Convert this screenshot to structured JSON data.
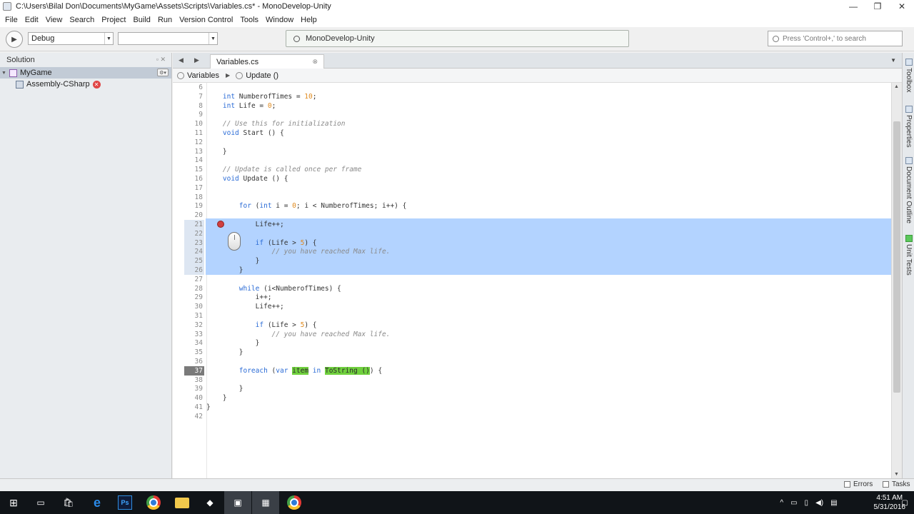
{
  "window": {
    "title": "C:\\Users\\Bilal Don\\Documents\\MyGame\\Assets\\Scripts\\Variables.cs* - MonoDevelop-Unity",
    "controls": [
      "—",
      "❐",
      "✕"
    ]
  },
  "menu": [
    "File",
    "Edit",
    "View",
    "Search",
    "Project",
    "Build",
    "Run",
    "Version Control",
    "Tools",
    "Window",
    "Help"
  ],
  "toolbar": {
    "config_value": "Debug",
    "target_value": "",
    "status_text": "MonoDevelop-Unity",
    "search_placeholder": "Press 'Control+,' to search"
  },
  "solution": {
    "header": "Solution",
    "project": "MyGame",
    "assembly": "Assembly-CSharp"
  },
  "tabs": [
    {
      "label": "Variables.cs"
    }
  ],
  "breadcrumb": {
    "class": "Variables",
    "method": "Update ()"
  },
  "editor": {
    "current_line": 37,
    "selected_lines": [
      21,
      26
    ],
    "lines": [
      {
        "n": "6",
        "parts": []
      },
      {
        "n": "7",
        "parts": [
          {
            "t": "    "
          },
          {
            "t": "int",
            "c": "kw"
          },
          {
            "t": " NumberofTimes = "
          },
          {
            "t": "10",
            "c": "num"
          },
          {
            "t": ";"
          }
        ]
      },
      {
        "n": "8",
        "parts": [
          {
            "t": "    "
          },
          {
            "t": "int",
            "c": "kw"
          },
          {
            "t": " Life = "
          },
          {
            "t": "0",
            "c": "num"
          },
          {
            "t": ";"
          }
        ]
      },
      {
        "n": "9",
        "parts": []
      },
      {
        "n": "10",
        "parts": [
          {
            "t": "    "
          },
          {
            "t": "// Use this for initialization",
            "c": "cm"
          }
        ]
      },
      {
        "n": "11",
        "parts": [
          {
            "t": "    "
          },
          {
            "t": "void",
            "c": "kw"
          },
          {
            "t": " Start () {"
          }
        ]
      },
      {
        "n": "12",
        "parts": []
      },
      {
        "n": "13",
        "parts": [
          {
            "t": "    }"
          }
        ]
      },
      {
        "n": "14",
        "parts": []
      },
      {
        "n": "15",
        "parts": [
          {
            "t": "    "
          },
          {
            "t": "// Update is called once per frame",
            "c": "cm"
          }
        ]
      },
      {
        "n": "16",
        "parts": [
          {
            "t": "    "
          },
          {
            "t": "void",
            "c": "kw"
          },
          {
            "t": " Update () {"
          }
        ]
      },
      {
        "n": "17",
        "parts": []
      },
      {
        "n": "18",
        "parts": []
      },
      {
        "n": "19",
        "parts": [
          {
            "t": "        "
          },
          {
            "t": "for",
            "c": "kw"
          },
          {
            "t": " ("
          },
          {
            "t": "int",
            "c": "kw"
          },
          {
            "t": " i = "
          },
          {
            "t": "0",
            "c": "num"
          },
          {
            "t": "; i < NumberofTimes; i++) {"
          }
        ]
      },
      {
        "n": "20",
        "parts": []
      },
      {
        "n": "21",
        "parts": [
          {
            "t": "            Life++;"
          }
        ]
      },
      {
        "n": "22",
        "parts": []
      },
      {
        "n": "23",
        "parts": [
          {
            "t": "            "
          },
          {
            "t": "if",
            "c": "kw"
          },
          {
            "t": " (Life > "
          },
          {
            "t": "5",
            "c": "num"
          },
          {
            "t": ") {"
          }
        ]
      },
      {
        "n": "24",
        "parts": [
          {
            "t": "                "
          },
          {
            "t": "// you have reached Max life.",
            "c": "cm"
          }
        ]
      },
      {
        "n": "25",
        "parts": [
          {
            "t": "            }"
          }
        ]
      },
      {
        "n": "26",
        "parts": [
          {
            "t": "        }"
          }
        ]
      },
      {
        "n": "27",
        "parts": []
      },
      {
        "n": "28",
        "parts": [
          {
            "t": "        "
          },
          {
            "t": "while",
            "c": "kw"
          },
          {
            "t": " (i<NumberofTimes) {"
          }
        ]
      },
      {
        "n": "29",
        "parts": [
          {
            "t": "            i++;"
          }
        ]
      },
      {
        "n": "30",
        "parts": [
          {
            "t": "            Life++;"
          }
        ]
      },
      {
        "n": "31",
        "parts": []
      },
      {
        "n": "32",
        "parts": [
          {
            "t": "            "
          },
          {
            "t": "if",
            "c": "kw"
          },
          {
            "t": " (Life > "
          },
          {
            "t": "5",
            "c": "num"
          },
          {
            "t": ") {"
          }
        ]
      },
      {
        "n": "33",
        "parts": [
          {
            "t": "                "
          },
          {
            "t": "// you have reached Max life.",
            "c": "cm"
          }
        ]
      },
      {
        "n": "34",
        "parts": [
          {
            "t": "            }"
          }
        ]
      },
      {
        "n": "35",
        "parts": [
          {
            "t": "        }"
          }
        ]
      },
      {
        "n": "36",
        "parts": []
      },
      {
        "n": "37",
        "parts": [
          {
            "t": "        "
          },
          {
            "t": "foreach",
            "c": "kw"
          },
          {
            "t": " ("
          },
          {
            "t": "var",
            "c": "kw"
          },
          {
            "t": " "
          },
          {
            "t": "item",
            "c": "hl"
          },
          {
            "t": " "
          },
          {
            "t": "in",
            "c": "kw"
          },
          {
            "t": " "
          },
          {
            "t": "ToString ()",
            "c": "hl"
          },
          {
            "t": ") {"
          }
        ]
      },
      {
        "n": "38",
        "parts": []
      },
      {
        "n": "39",
        "parts": [
          {
            "t": "        }"
          }
        ]
      },
      {
        "n": "40",
        "parts": [
          {
            "t": "    }"
          }
        ]
      },
      {
        "n": "41",
        "parts": [
          {
            "t": "}"
          }
        ]
      },
      {
        "n": "42",
        "parts": []
      }
    ]
  },
  "dock": [
    "Toolbox",
    "Properties",
    "Document Outline",
    "Unit Tests"
  ],
  "bottom": {
    "errors": "Errors",
    "tasks": "Tasks"
  },
  "clock": {
    "time": "4:51 AM",
    "date": "5/31/2016"
  },
  "colors": {
    "keyword": "#2a6bd6",
    "number": "#e08a1e",
    "comment": "#8a8a8a",
    "selection": "#b3d3ff",
    "highlight": "#70d03e"
  }
}
